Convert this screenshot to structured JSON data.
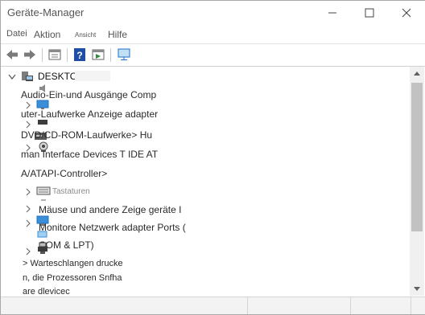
{
  "window": {
    "title": "Geräte-Manager"
  },
  "menu": {
    "file": "Datei",
    "action": "Aktion",
    "view": "Ansicht",
    "help": "Hilfe"
  },
  "tree": {
    "root": "DESKTOP",
    "lines": {
      "l1": "Audio-Ein-und Ausgänge Comp",
      "l2": "uter-Laufwerke Anzeige adapter",
      "l3": "DVD/CD-ROM-Laufwerke> Hu",
      "l4": "man Interface Devices T IDE AT",
      "l5": "A/ATAPI-Controller>",
      "l6": "Tastaturen",
      "l7": "Mäuse und andere Zeige geräte I",
      "l8": "Monitore Netzwerk adapter Ports (",
      "l9": "COM & LPT)",
      "l10": "> Warteschlangen drucke",
      "l11": "n, die Prozessoren Snfha",
      "l12": "are dlevicec"
    }
  },
  "colors": {
    "accent": "#1f6fc5",
    "scroll_thumb": "#c2c2c2"
  },
  "icons": [
    "back-arrow-icon",
    "forward-arrow-icon",
    "properties-icon",
    "help-icon",
    "refresh-icon",
    "monitor-scan-icon",
    "computer-icon",
    "speaker-icon",
    "monitor-icon",
    "disk-drive-icon",
    "webcam-icon",
    "keyboard-icon",
    "mouse-icon",
    "printer-icon"
  ]
}
